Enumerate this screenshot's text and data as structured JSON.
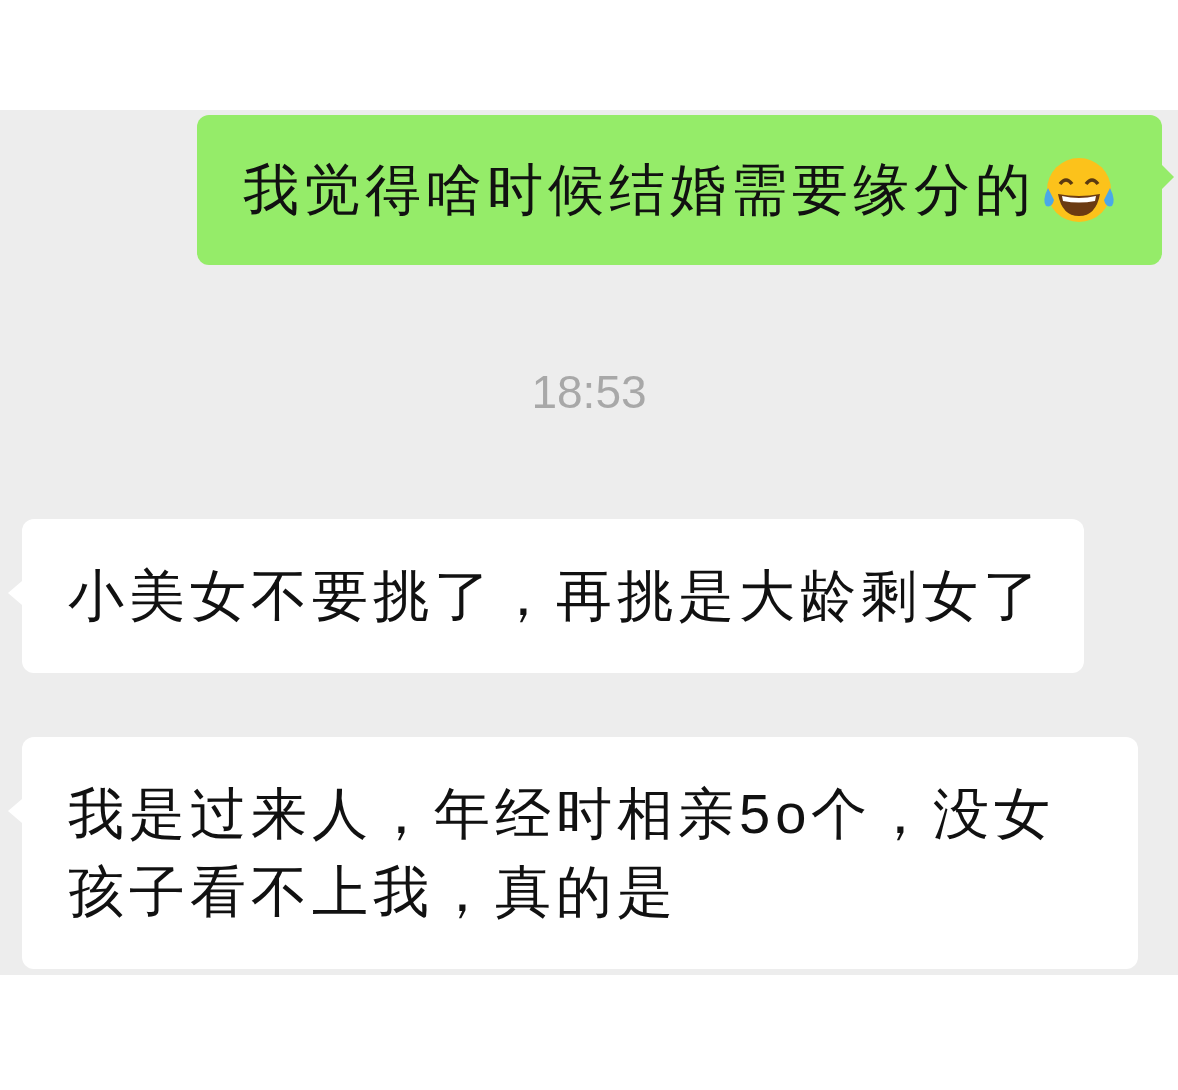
{
  "messages": [
    {
      "kind": "outgoing",
      "text": "我觉得啥时候结婚需要缘分的",
      "tears_of_joy_emoji": true
    },
    {
      "kind": "timestamp",
      "text": "18:53"
    },
    {
      "kind": "incoming",
      "text": "小美女不要挑了，再挑是大龄剩女了"
    },
    {
      "kind": "incoming",
      "text": "我是过来人，年经时相亲5o个，没女孩子看不上我，真的是"
    }
  ]
}
